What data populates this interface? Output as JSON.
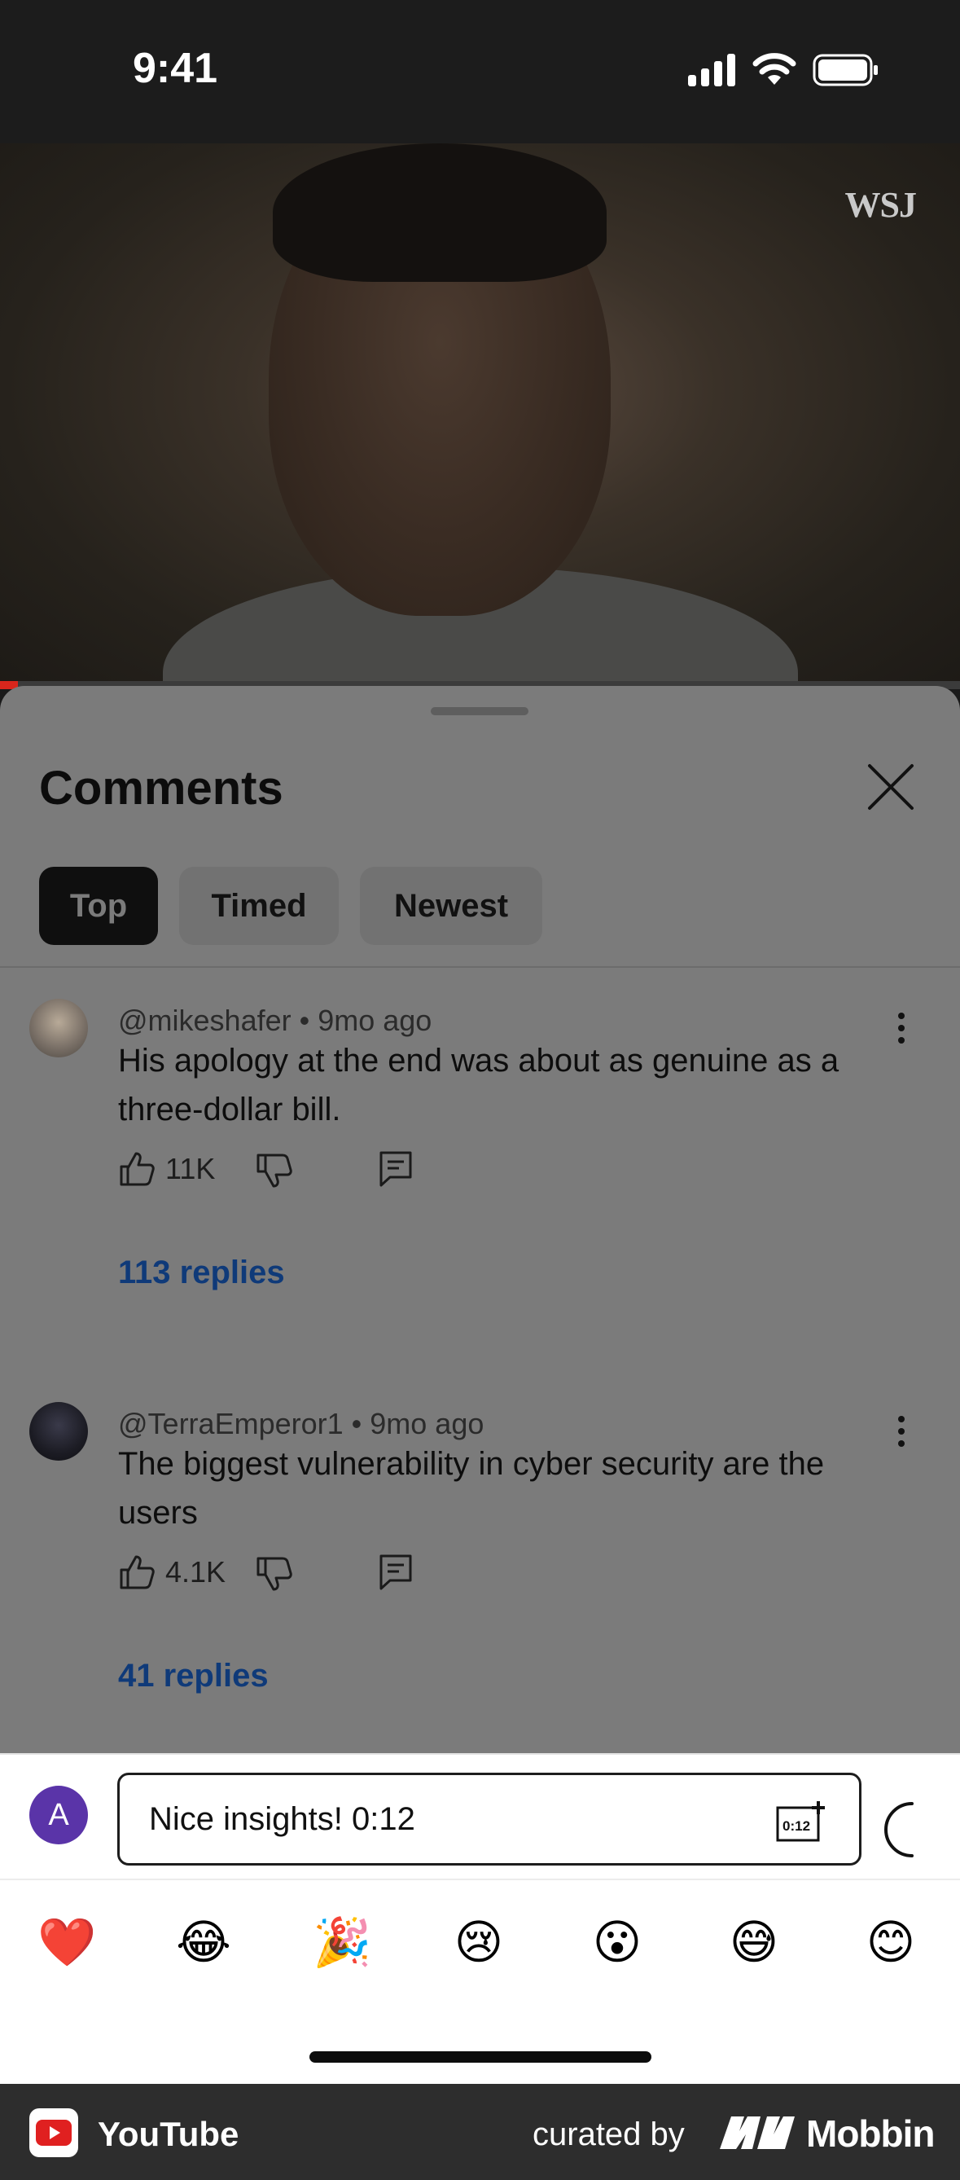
{
  "status_bar": {
    "time": "9:41"
  },
  "video": {
    "watermark": "WSJ"
  },
  "comments_sheet": {
    "title": "Comments",
    "filters": [
      "Top",
      "Timed",
      "Newest"
    ],
    "selected_filter": "Top",
    "comments": [
      {
        "author": "@mikeshafer",
        "age": "9mo ago",
        "text": "His apology at the end was about as genuine as a three-dollar bill.",
        "likes": "11K",
        "replies": "113 replies"
      },
      {
        "author": "@TerraEmperor1",
        "age": "9mo ago",
        "text": "The biggest vulnerability in cyber security are the users",
        "likes": "4.1K",
        "replies": "41 replies"
      }
    ]
  },
  "composer": {
    "avatar_letter": "A",
    "value": "Nice insights! 0:12",
    "timestamp_icon_label": "0:12"
  },
  "emoji_bar": [
    "❤️",
    "😂",
    "🎉",
    "😢",
    "😮",
    "😅",
    "😊"
  ],
  "footer": {
    "app": "YouTube",
    "curated_by": "curated by",
    "brand": "Mobbin"
  },
  "colors": {
    "reply_link": "#0f3a79",
    "accent": "#d9261c",
    "avatar_me": "#5a34a8"
  }
}
